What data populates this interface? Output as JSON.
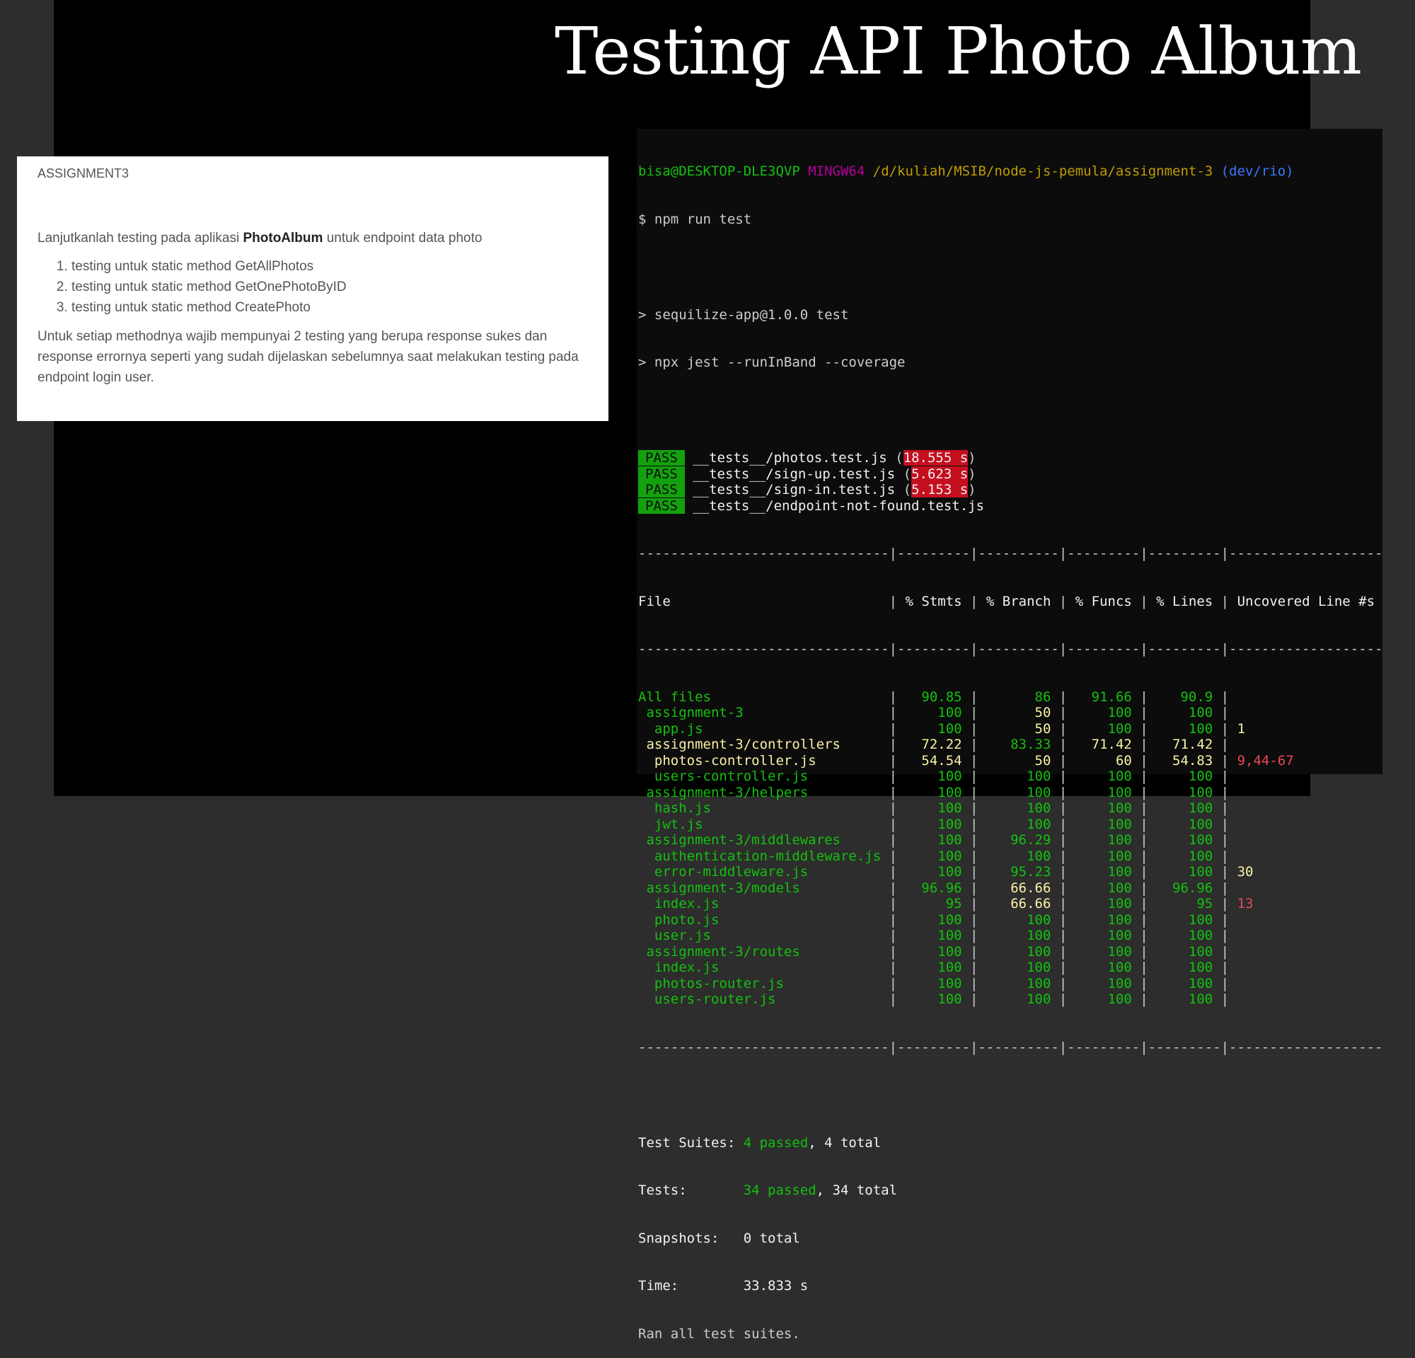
{
  "title": "Testing API Photo Album",
  "doc": {
    "heading": "ASSIGNMENT3",
    "intro_pre": "Lanjutkanlah testing pada aplikasi ",
    "intro_bold": "PhotoAlbum",
    "intro_post": " untuk endpoint data photo",
    "items": [
      "testing untuk static method GetAllPhotos",
      "testing untuk static method GetOnePhotoByID",
      "testing untuk static method CreatePhoto"
    ],
    "note": "Untuk setiap methodnya wajib mempunyai  2 testing yang berupa response sukes dan response errornya seperti yang sudah dijelaskan sebelumnya saat melakukan testing pada endpoint login user."
  },
  "terminal": {
    "prompt_user": "bisa@DESKTOP-DLE3QVP",
    "prompt_shell": "MINGW64",
    "prompt_path": "/d/kuliah/MSIB/node-js-pemula/assignment-3",
    "prompt_branch": "(dev/rio)",
    "command": "$ npm run test",
    "script_line1": "> sequilize-app@1.0.0 test",
    "script_line2": "> npx jest --runInBand --coverage",
    "pass_label": "PASS",
    "results": [
      {
        "file": "__tests__/photos.test.js",
        "time": "18.555 s"
      },
      {
        "file": "__tests__/sign-up.test.js",
        "time": "5.623 s"
      },
      {
        "file": "__tests__/sign-in.test.js",
        "time": "5.153 s"
      },
      {
        "file": "__tests__/endpoint-not-found.test.js",
        "time": ""
      }
    ],
    "separator": "-------------------------------|---------|----------|---------|---------|-------------------",
    "table_header": {
      "file": "File",
      "stmts": "% Stmts",
      "branch": "% Branch",
      "funcs": "% Funcs",
      "lines": "% Lines",
      "uncovered": "Uncovered Line #s"
    },
    "rows": [
      {
        "file": "All files",
        "stmts": "90.85",
        "branch": "86",
        "funcs": "91.66",
        "lines": "90.9",
        "uncovered": "",
        "indent": 0,
        "c": [
          "g",
          "g",
          "g",
          "g",
          "g"
        ]
      },
      {
        "file": "assignment-3",
        "stmts": "100",
        "branch": "50",
        "funcs": "100",
        "lines": "100",
        "uncovered": "",
        "indent": 1,
        "c": [
          "g",
          "g",
          "yb",
          "g",
          "g"
        ]
      },
      {
        "file": "app.js",
        "stmts": "100",
        "branch": "50",
        "funcs": "100",
        "lines": "100",
        "uncovered": "1",
        "indent": 2,
        "c": [
          "g",
          "g",
          "yb",
          "g",
          "g"
        ],
        "uc": "yb"
      },
      {
        "file": "assignment-3/controllers",
        "stmts": "72.22",
        "branch": "83.33",
        "funcs": "71.42",
        "lines": "71.42",
        "uncovered": "",
        "indent": 1,
        "c": [
          "yb",
          "yb",
          "g",
          "yb",
          "yb"
        ]
      },
      {
        "file": "photos-controller.js",
        "stmts": "54.54",
        "branch": "50",
        "funcs": "60",
        "lines": "54.83",
        "uncovered": "9,44-67",
        "indent": 2,
        "c": [
          "yb",
          "yb",
          "yb",
          "yb",
          "yb"
        ],
        "uc": "r"
      },
      {
        "file": "users-controller.js",
        "stmts": "100",
        "branch": "100",
        "funcs": "100",
        "lines": "100",
        "uncovered": "",
        "indent": 2,
        "c": [
          "g",
          "g",
          "g",
          "g",
          "g"
        ]
      },
      {
        "file": "assignment-3/helpers",
        "stmts": "100",
        "branch": "100",
        "funcs": "100",
        "lines": "100",
        "uncovered": "",
        "indent": 1,
        "c": [
          "g",
          "g",
          "g",
          "g",
          "g"
        ]
      },
      {
        "file": "hash.js",
        "stmts": "100",
        "branch": "100",
        "funcs": "100",
        "lines": "100",
        "uncovered": "",
        "indent": 2,
        "c": [
          "g",
          "g",
          "g",
          "g",
          "g"
        ]
      },
      {
        "file": "jwt.js",
        "stmts": "100",
        "branch": "100",
        "funcs": "100",
        "lines": "100",
        "uncovered": "",
        "indent": 2,
        "c": [
          "g",
          "g",
          "g",
          "g",
          "g"
        ]
      },
      {
        "file": "assignment-3/middlewares",
        "stmts": "100",
        "branch": "96.29",
        "funcs": "100",
        "lines": "100",
        "uncovered": "",
        "indent": 1,
        "c": [
          "g",
          "g",
          "g",
          "g",
          "g"
        ]
      },
      {
        "file": "authentication-middleware.js",
        "stmts": "100",
        "branch": "100",
        "funcs": "100",
        "lines": "100",
        "uncovered": "",
        "indent": 2,
        "c": [
          "g",
          "g",
          "g",
          "g",
          "g"
        ]
      },
      {
        "file": "error-middleware.js",
        "stmts": "100",
        "branch": "95.23",
        "funcs": "100",
        "lines": "100",
        "uncovered": "30",
        "indent": 2,
        "c": [
          "g",
          "g",
          "g",
          "g",
          "g"
        ],
        "uc": "yb"
      },
      {
        "file": "assignment-3/models",
        "stmts": "96.96",
        "branch": "66.66",
        "funcs": "100",
        "lines": "96.96",
        "uncovered": "",
        "indent": 1,
        "c": [
          "g",
          "g",
          "yb",
          "g",
          "g"
        ]
      },
      {
        "file": "index.js",
        "stmts": "95",
        "branch": "66.66",
        "funcs": "100",
        "lines": "95",
        "uncovered": "13",
        "indent": 2,
        "c": [
          "g",
          "g",
          "yb",
          "g",
          "g"
        ],
        "uc": "r"
      },
      {
        "file": "photo.js",
        "stmts": "100",
        "branch": "100",
        "funcs": "100",
        "lines": "100",
        "uncovered": "",
        "indent": 2,
        "c": [
          "g",
          "g",
          "g",
          "g",
          "g"
        ]
      },
      {
        "file": "user.js",
        "stmts": "100",
        "branch": "100",
        "funcs": "100",
        "lines": "100",
        "uncovered": "",
        "indent": 2,
        "c": [
          "g",
          "g",
          "g",
          "g",
          "g"
        ]
      },
      {
        "file": "assignment-3/routes",
        "stmts": "100",
        "branch": "100",
        "funcs": "100",
        "lines": "100",
        "uncovered": "",
        "indent": 1,
        "c": [
          "g",
          "g",
          "g",
          "g",
          "g"
        ]
      },
      {
        "file": "index.js",
        "stmts": "100",
        "branch": "100",
        "funcs": "100",
        "lines": "100",
        "uncovered": "",
        "indent": 2,
        "c": [
          "g",
          "g",
          "g",
          "g",
          "g"
        ]
      },
      {
        "file": "photos-router.js",
        "stmts": "100",
        "branch": "100",
        "funcs": "100",
        "lines": "100",
        "uncovered": "",
        "indent": 2,
        "c": [
          "g",
          "g",
          "g",
          "g",
          "g"
        ]
      },
      {
        "file": "users-router.js",
        "stmts": "100",
        "branch": "100",
        "funcs": "100",
        "lines": "100",
        "uncovered": "",
        "indent": 2,
        "c": [
          "g",
          "g",
          "g",
          "g",
          "g"
        ]
      }
    ],
    "summary": {
      "suites_label": "Test Suites: ",
      "suites_passed": "4 passed",
      "suites_total": ", 4 total",
      "tests_label": "Tests:       ",
      "tests_passed": "34 passed",
      "tests_total": ", 34 total",
      "snapshots": "Snapshots:   0 total",
      "time": "Time:        33.833 s",
      "ran": "Ran all test suites."
    }
  }
}
